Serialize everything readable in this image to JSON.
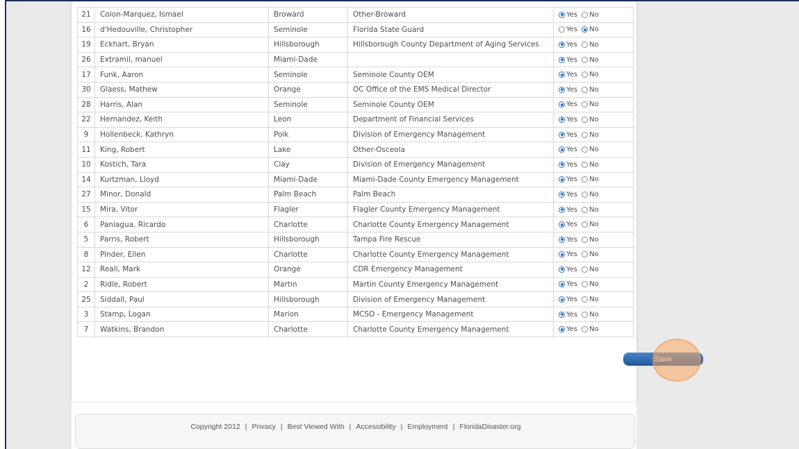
{
  "roster": {
    "yes_label": "Yes",
    "no_label": "No",
    "rows": [
      {
        "id": "21",
        "name": "Colon-Marquez, Ismael",
        "county": "Broward",
        "agency": "Other-Broward",
        "attending": "yes"
      },
      {
        "id": "16",
        "name": "d'Hedouville, Christopher",
        "county": "Seminole",
        "agency": "Florida State Guard",
        "attending": "no"
      },
      {
        "id": "19",
        "name": "Eckhart, Bryan",
        "county": "Hillsborough",
        "agency": "Hillsborough County Department of Aging Services",
        "attending": "yes"
      },
      {
        "id": "26",
        "name": "Extramil, manuel",
        "county": "Miami-Dade",
        "agency": "",
        "attending": "yes"
      },
      {
        "id": "17",
        "name": "Funk, Aaron",
        "county": "Seminole",
        "agency": "Seminole County OEM",
        "attending": "yes"
      },
      {
        "id": "30",
        "name": "Glaess, Mathew",
        "county": "Orange",
        "agency": "OC Office of the EMS Medical Director",
        "attending": "yes"
      },
      {
        "id": "28",
        "name": "Harris, Alan",
        "county": "Seminole",
        "agency": "Seminole County OEM",
        "attending": "yes"
      },
      {
        "id": "22",
        "name": "Hernandez, Keith",
        "county": "Leon",
        "agency": "Department of Financial Services",
        "attending": "yes"
      },
      {
        "id": "9",
        "name": "Hollenbeck, Kathryn",
        "county": "Polk",
        "agency": "Division of Emergency Management",
        "attending": "yes"
      },
      {
        "id": "11",
        "name": "King, Robert",
        "county": "Lake",
        "agency": "Other-Osceola",
        "attending": "yes"
      },
      {
        "id": "10",
        "name": "Kostich, Tara",
        "county": "Clay",
        "agency": "Division of Emergency Management",
        "attending": "yes"
      },
      {
        "id": "14",
        "name": "Kurtzman, Lloyd",
        "county": "Miami-Dade",
        "agency": "Miami-Dade County Emergency Management",
        "attending": "yes"
      },
      {
        "id": "27",
        "name": "Minor, Donald",
        "county": "Palm Beach",
        "agency": "Palm Beach",
        "attending": "yes"
      },
      {
        "id": "15",
        "name": "Mira, Vitor",
        "county": "Flagler",
        "agency": "Flagler County Emergency Management",
        "attending": "yes"
      },
      {
        "id": "6",
        "name": "Paniagua, Ricardo",
        "county": "Charlotte",
        "agency": "Charlotte County Emergency Management",
        "attending": "yes"
      },
      {
        "id": "5",
        "name": "Parris, Robert",
        "county": "Hillsborough",
        "agency": "Tampa Fire Rescue",
        "attending": "yes"
      },
      {
        "id": "8",
        "name": "Pinder, Ellen",
        "county": "Charlotte",
        "agency": "Charlotte County Emergency Management",
        "attending": "yes"
      },
      {
        "id": "12",
        "name": "Reali, Mark",
        "county": "Orange",
        "agency": "CDR Emergency Management",
        "attending": "yes"
      },
      {
        "id": "2",
        "name": "Ridle, Robert",
        "county": "Martin",
        "agency": "Martin County Emergency Management",
        "attending": "yes"
      },
      {
        "id": "25",
        "name": "Siddall, Paul",
        "county": "Hillsborough",
        "agency": "Division of Emergency Management",
        "attending": "yes"
      },
      {
        "id": "3",
        "name": "Stamp, Logan",
        "county": "Marion",
        "agency": "MCSO - Emergency Management",
        "attending": "yes"
      },
      {
        "id": "7",
        "name": "Watkins, Brandon",
        "county": "Charlotte",
        "agency": "Charlotte County Emergency Management",
        "attending": "yes"
      }
    ]
  },
  "actions": {
    "save_label": "Save"
  },
  "footer": {
    "links": [
      "Copyright 2012",
      "Privacy",
      "Best Viewed With",
      "Accessibility",
      "Employment",
      "FloridaDisaster.org"
    ]
  }
}
